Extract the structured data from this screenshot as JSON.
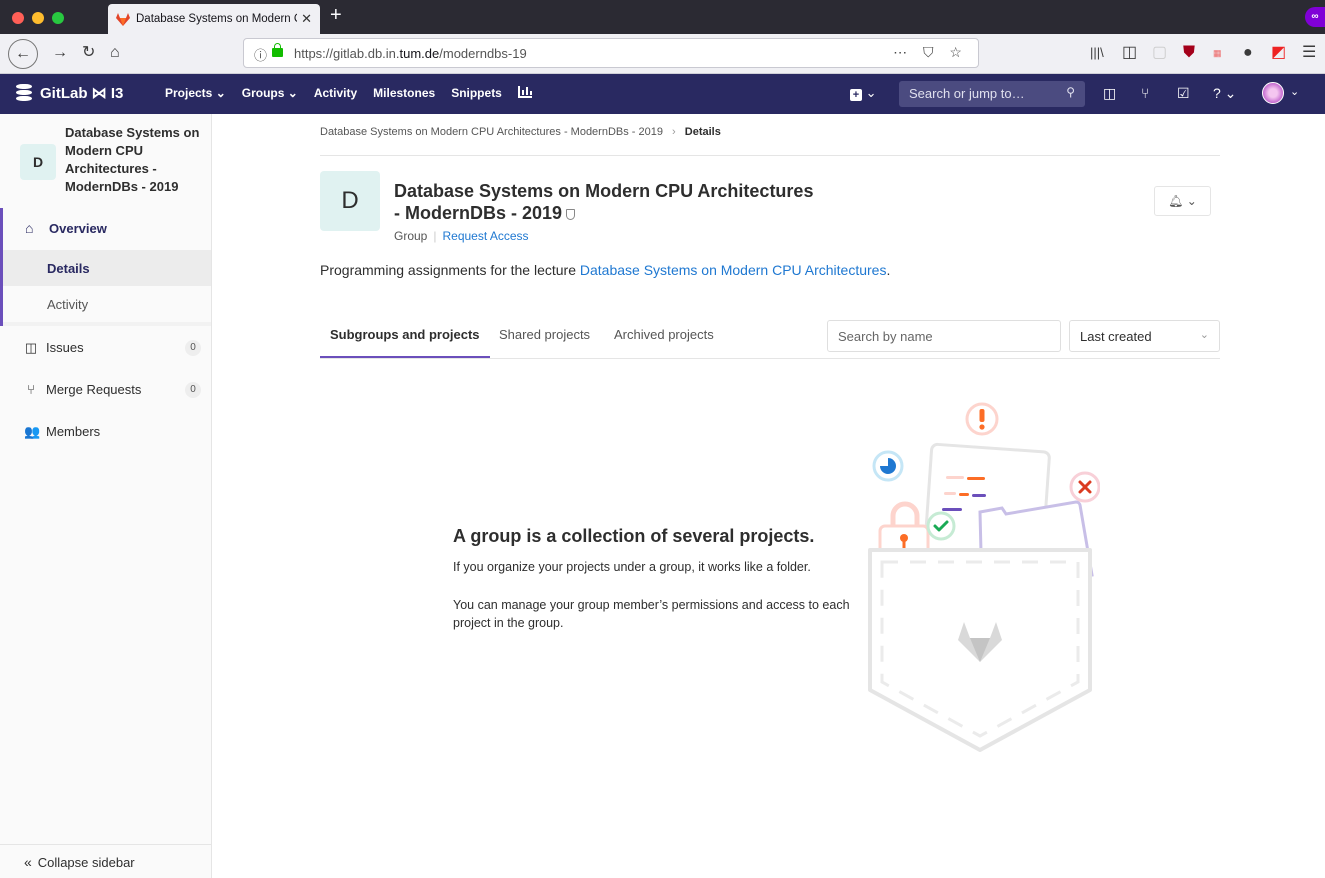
{
  "browser": {
    "tab_title": "Database Systems on Modern CPU Architectures",
    "url_prefix": "https://gitlab.db.in.",
    "url_domain": "tum.de",
    "url_path": "/moderndbs-19",
    "url_actions": "⋯ ⛉ ☆"
  },
  "navbar": {
    "brand": "GitLab ⋈ I3",
    "links": [
      "Projects ⌄",
      "Groups ⌄",
      "Activity",
      "Milestones",
      "Snippets"
    ],
    "search_placeholder": "Search or jump to…"
  },
  "sidebar": {
    "group_initial": "D",
    "group_name": "Database Systems on Modern CPU Architectures - ModernDBs - 2019",
    "overview_label": "Overview",
    "details_label": "Details",
    "activity_label": "Activity",
    "issues_label": "Issues",
    "issues_count": "0",
    "mr_label": "Merge Requests",
    "mr_count": "0",
    "members_label": "Members",
    "collapse_label": "Collapse sidebar"
  },
  "breadcrumb": {
    "group": "Database Systems on Modern CPU Architectures - ModernDBs - 2019",
    "separator": "›",
    "current": "Details"
  },
  "group": {
    "initial": "D",
    "title": "Database Systems on Modern CPU Architectures - ModernDBs - 2019",
    "type_label": "Group",
    "request_access": "Request Access",
    "description_prefix": "Programming assignments for the lecture ",
    "description_link": "Database Systems on Modern CPU Architectures",
    "description_suffix": "."
  },
  "tabs": {
    "subgroups": "Subgroups and projects",
    "shared": "Shared projects",
    "archived": "Archived projects",
    "search_placeholder": "Search by name",
    "sort_selected": "Last created"
  },
  "empty_state": {
    "title": "A group is a collection of several projects.",
    "line1": "If you organize your projects under a group, it works like a folder.",
    "line2": "You can manage your group member’s permissions and access to each project in the group."
  },
  "colors": {
    "navbar_bg": "#292961",
    "accent": "#6b4fbb",
    "link": "#1f78d1",
    "avatar_bg": "#e0f2f1"
  }
}
